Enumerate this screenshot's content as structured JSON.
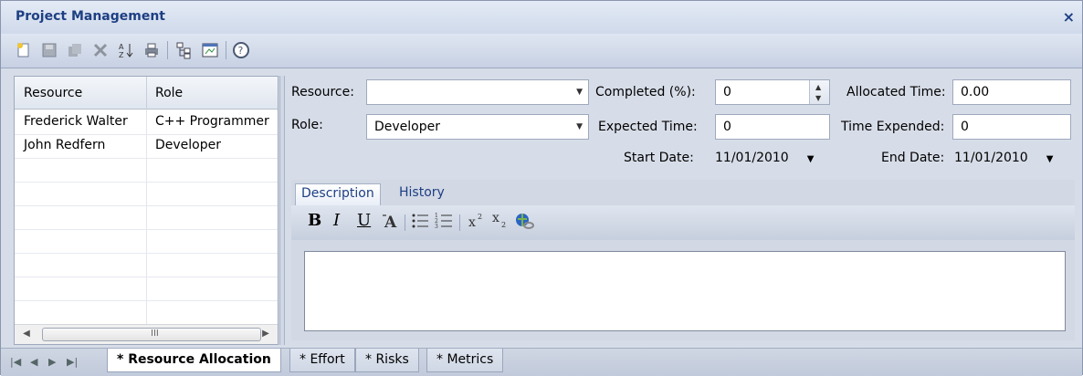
{
  "window": {
    "title": "Project Management",
    "close_label": "×"
  },
  "toolbar": {
    "icons": [
      "new-document-icon",
      "save-icon",
      "copy-icon",
      "delete-icon",
      "sort-icon",
      "print-icon",
      "hierarchy-icon",
      "properties-icon",
      "help-icon"
    ]
  },
  "grid": {
    "headers": [
      "Resource",
      "Role"
    ],
    "rows": [
      [
        "Frederick Walter",
        "C++ Programmer"
      ],
      [
        "John Redfern",
        "Developer"
      ]
    ],
    "scroll_grip": "III"
  },
  "form": {
    "resource_label": "Resource:",
    "resource_value": "",
    "role_label": "Role:",
    "role_value": "Developer",
    "completed_label": "Completed (%):",
    "completed_value": "0",
    "expected_label": "Expected Time:",
    "expected_value": "0",
    "start_label": "Start Date:",
    "start_value": "11/01/2010",
    "allocated_label": "Allocated Time:",
    "allocated_value": "0.00",
    "expended_label": "Time Expended:",
    "expended_value": "0",
    "end_label": "End Date:",
    "end_value": "11/01/2010"
  },
  "tabs": {
    "description": "Description",
    "history": "History"
  },
  "richtext": {
    "bold": "B",
    "italic": "I",
    "underline": "U"
  },
  "bottom_tabs": [
    "* Resource Allocation",
    "* Effort",
    "* Risks",
    "* Metrics"
  ]
}
